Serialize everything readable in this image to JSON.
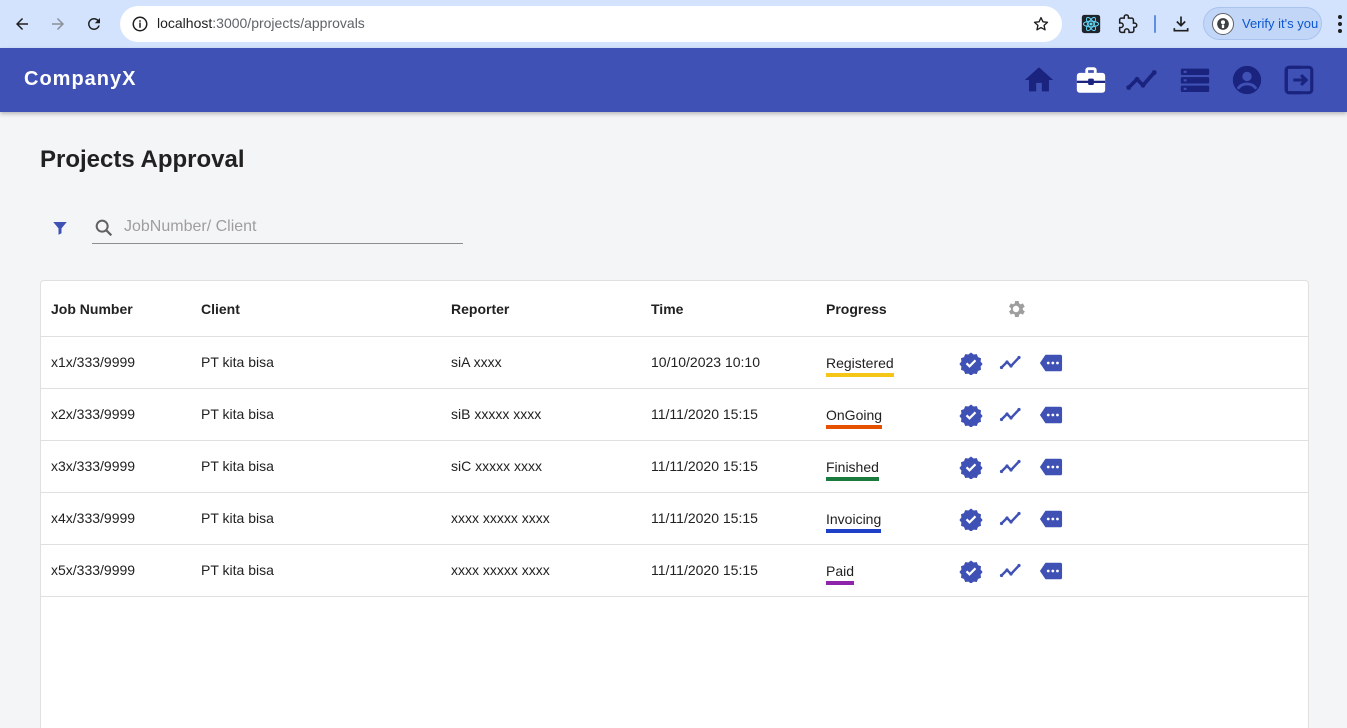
{
  "browser": {
    "url_host": "localhost",
    "url_path": ":3000/projects/approvals",
    "profile_label": "Verify it's you"
  },
  "app": {
    "brand": "CompanyX",
    "nav_icons": [
      "home-icon",
      "work-icon",
      "analytics-icon",
      "storage-icon",
      "account-icon",
      "logout-icon"
    ]
  },
  "page": {
    "title": "Projects Approval"
  },
  "search": {
    "placeholder": "JobNumber/ Client",
    "value": ""
  },
  "table": {
    "columns": {
      "job_number": "Job Number",
      "client": "Client",
      "reporter": "Reporter",
      "time": "Time",
      "progress": "Progress"
    },
    "rows": [
      {
        "job_number": "x1x/333/9999",
        "client": "PT kita bisa",
        "reporter": "siA xxxx",
        "time": "10/10/2023 10:10",
        "progress": "Registered",
        "progress_color": "#f5c518"
      },
      {
        "job_number": "x2x/333/9999",
        "client": "PT kita bisa",
        "reporter": "siB xxxxx xxxx",
        "time": "11/11/2020 15:15",
        "progress": "OnGoing",
        "progress_color": "#e65100"
      },
      {
        "job_number": "x3x/333/9999",
        "client": "PT kita bisa",
        "reporter": "siC xxxxx xxxx",
        "time": "11/11/2020 15:15",
        "progress": "Finished",
        "progress_color": "#1b7a3e"
      },
      {
        "job_number": "x4x/333/9999",
        "client": "PT kita bisa",
        "reporter": "xxxx xxxxx xxxx",
        "time": "11/11/2020 15:15",
        "progress": "Invoicing",
        "progress_color": "#1e40c8"
      },
      {
        "job_number": "x5x/333/9999",
        "client": "PT kita bisa",
        "reporter": "xxxx xxxxx xxxx",
        "time": "11/11/2020 15:15",
        "progress": "Paid",
        "progress_color": "#8e24aa"
      }
    ],
    "row_actions": [
      "verified-icon",
      "timeline-icon",
      "more-details-icon"
    ]
  },
  "colors": {
    "primary": "#3f51b5",
    "appbar_icon": "#1a237e",
    "browser_bar": "#d3e3fd"
  }
}
